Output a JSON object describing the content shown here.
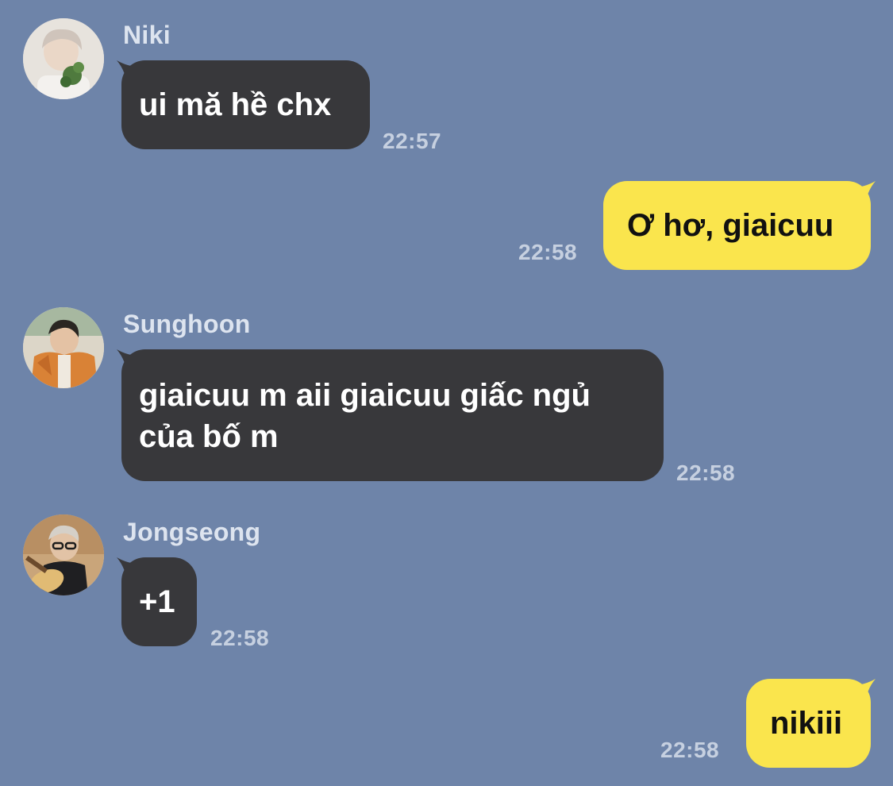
{
  "conversation": {
    "messages": [
      {
        "sender": "Niki",
        "direction": "incoming",
        "text": "ui mă hề chx",
        "time": "22:57",
        "avatar": "avatar-niki"
      },
      {
        "sender": "",
        "direction": "outgoing",
        "text": "Ơ hơ, giaicuu",
        "time": "22:58"
      },
      {
        "sender": "Sunghoon",
        "direction": "incoming",
        "text": "giaicuu m aii giaicuu giấc ngủ của bố m",
        "time": "22:58",
        "avatar": "avatar-sunghoon"
      },
      {
        "sender": "Jongseong",
        "direction": "incoming",
        "text": "+1",
        "time": "22:58",
        "avatar": "avatar-jongseong"
      },
      {
        "sender": "",
        "direction": "outgoing",
        "text": "nikiii",
        "time": "22:58"
      }
    ]
  },
  "colors": {
    "background": "#6e84a9",
    "incoming_bubble": "#38383b",
    "outgoing_bubble": "#fae54d",
    "timestamp": "#c6d0e0",
    "sender_name": "#dde4ef"
  }
}
